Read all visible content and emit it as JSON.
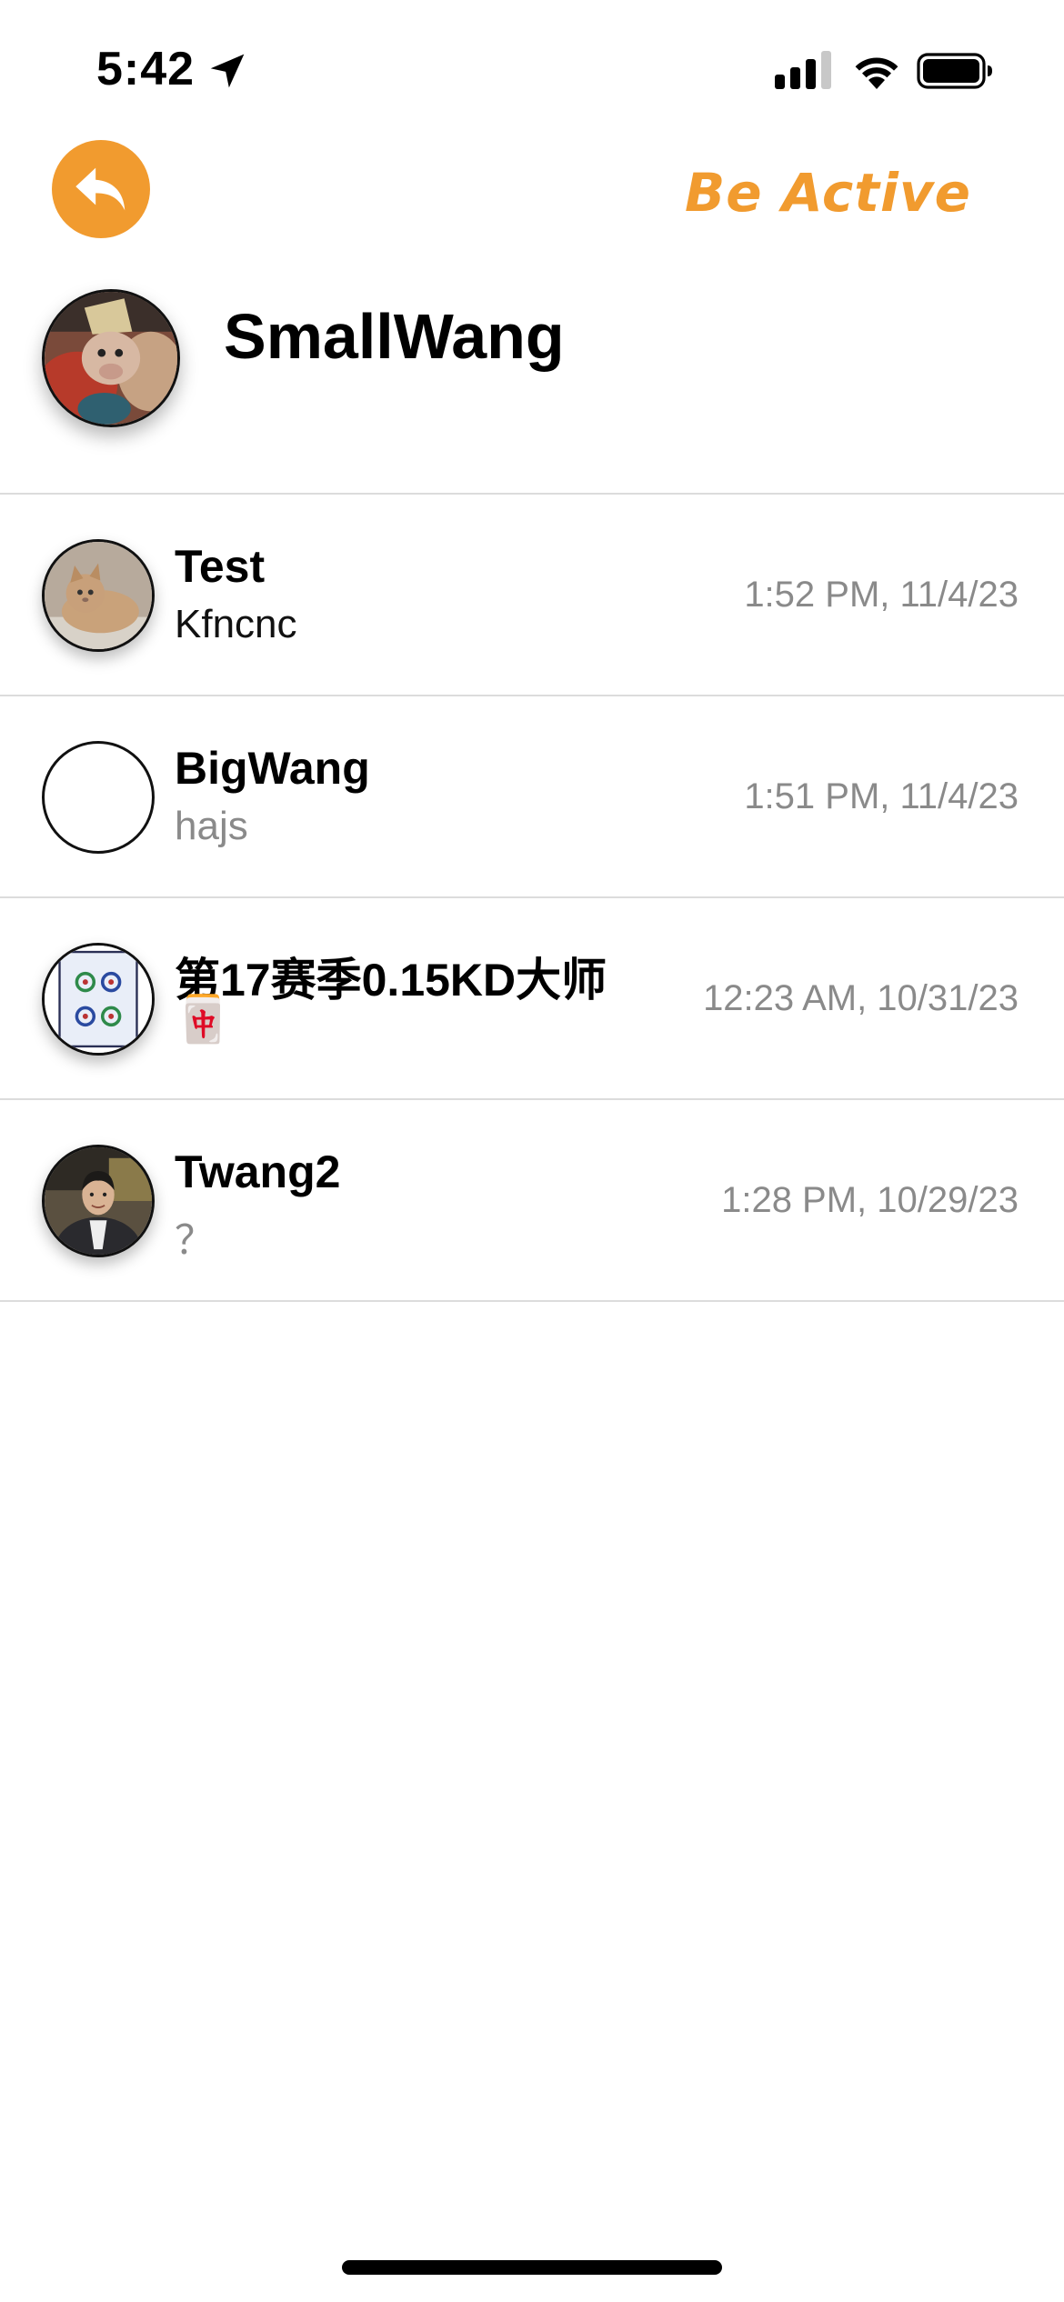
{
  "status_bar": {
    "time": "5:42",
    "icons": [
      "location-arrow-icon",
      "cellular-signal-icon",
      "wifi-icon",
      "battery-icon"
    ]
  },
  "nav": {
    "back_icon": "undo-arrow-icon",
    "action_label": "Be Active"
  },
  "profile": {
    "name": "SmallWang",
    "avatar": "monkey-photo"
  },
  "chats": [
    {
      "name": "Test",
      "last_message": "Kfncnc",
      "time": "1:52 PM, 11/4/23",
      "avatar": "cat-photo"
    },
    {
      "name": "BigWang",
      "last_message": "hajs",
      "time": "1:51 PM, 11/4/23",
      "avatar": "empty"
    },
    {
      "name": "第17赛季0.15KD大师",
      "last_message": "🀄",
      "time": "12:23 AM, 10/31/23",
      "avatar": "mahjong-four-circles"
    },
    {
      "name": "Twang2",
      "last_message": "？",
      "time": "1:28 PM, 10/29/23",
      "avatar": "person-photo"
    }
  ],
  "colors": {
    "accent": "#f19b2f",
    "divider": "#dcdcdc",
    "secondary_text": "#8a8a8a"
  }
}
